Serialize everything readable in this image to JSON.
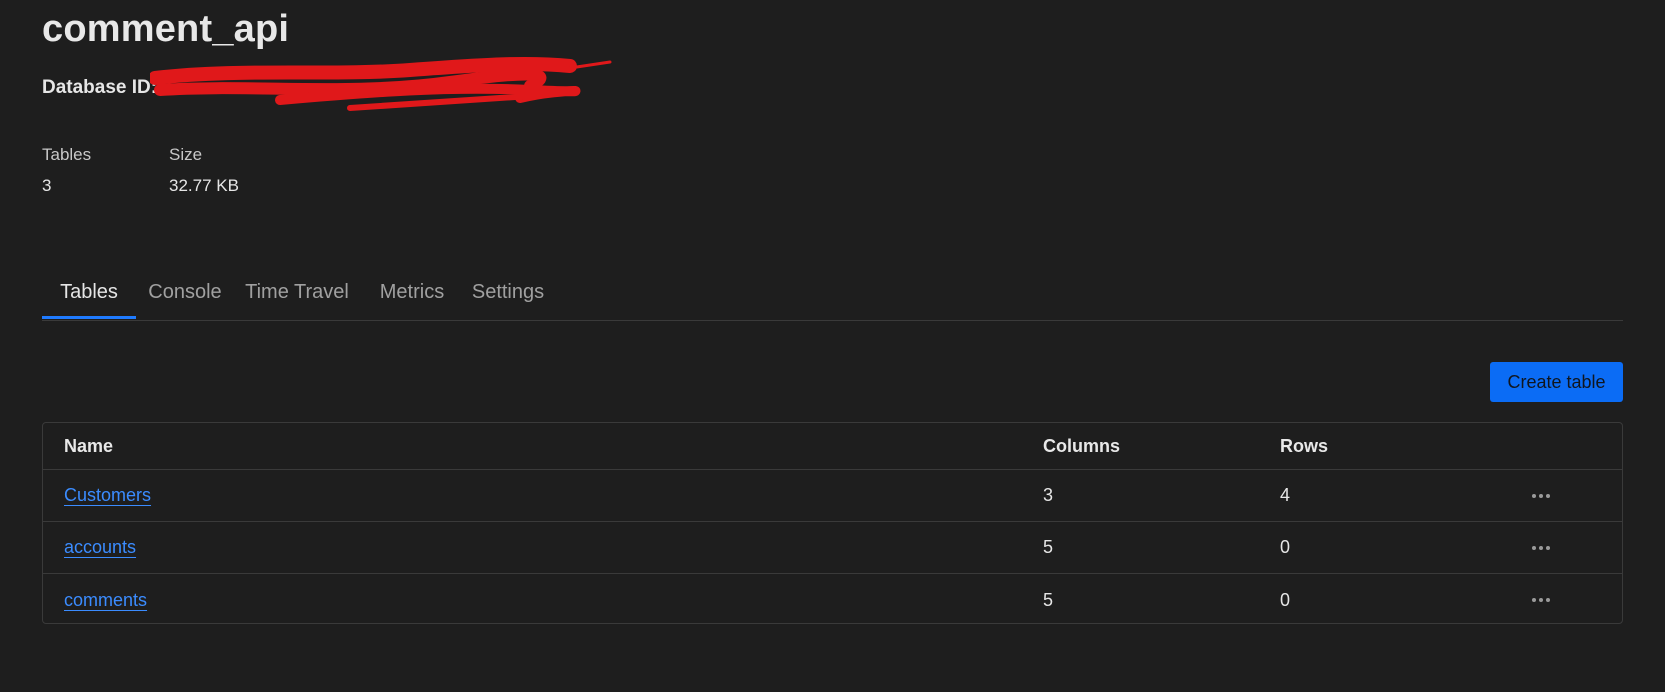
{
  "database": {
    "name": "comment_api",
    "id_label": "Database ID:",
    "stats": {
      "tables_label": "Tables",
      "tables_value": "3",
      "size_label": "Size",
      "size_value": "32.77 KB"
    }
  },
  "tabs": [
    {
      "label": "Tables",
      "active": true
    },
    {
      "label": "Console",
      "active": false
    },
    {
      "label": "Time Travel",
      "active": false
    },
    {
      "label": "Metrics",
      "active": false
    },
    {
      "label": "Settings",
      "active": false
    }
  ],
  "actions": {
    "create_table_label": "Create table"
  },
  "table": {
    "headers": {
      "name": "Name",
      "columns": "Columns",
      "rows": "Rows"
    },
    "rows": [
      {
        "name": "Customers",
        "columns": "3",
        "rows": "4"
      },
      {
        "name": "accounts",
        "columns": "5",
        "rows": "0"
      },
      {
        "name": "comments",
        "columns": "5",
        "rows": "0"
      }
    ]
  },
  "icons": {
    "row_menu": "more-horizontal-icon"
  },
  "colors": {
    "background": "#1e1e1e",
    "accent": "#1f7bff",
    "button": "#0b6cf5",
    "link": "#3b8cff",
    "redaction": "#e0181a"
  }
}
